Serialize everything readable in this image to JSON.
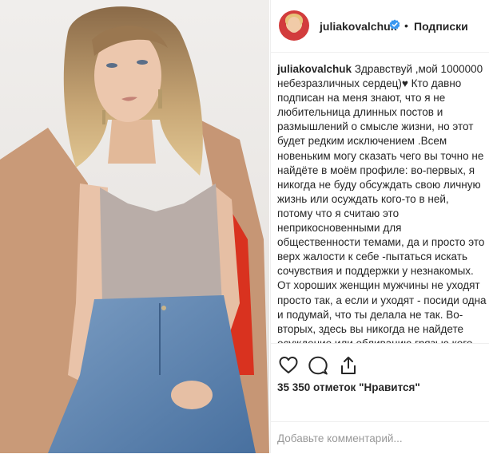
{
  "post": {
    "username": "juliakovalchuk",
    "separator": "•",
    "follow_label": "Подписки",
    "caption_text": "Здравствуй ,мой 1000000 небезразличных сердец)♥ Кто давно подписан на меня знают, что я не любительница длинных постов и размышлений о смысле жизни, но этот будет редким исключением .Всем новеньким могу сказать чего вы точно не найдёте в моём профиле: во-первых, я никогда не буду обсуждать свою личную жизнь или осуждать кого-то в ней, потому что я считаю это неприкосновенными для общественности темами, да и просто это верх жалости к себе -пытаться искать сочувствия и поддержки у незнакомых. От хороших женщин мужчины не уходят просто так, а если и уходят - посиди одна и подумай, что ты делала не так. Во-вторых, здесь вы никогда не найдете осуждение или обливанию грязью кого-",
    "likes_label": "35 350 отметок \"Нравится\"",
    "comment_placeholder": "Добавьте комментарий..."
  },
  "icons": {
    "avatar": "avatar-photo",
    "verified": "verified-badge-icon",
    "like": "heart-icon",
    "comment": "comment-bubble-icon",
    "share": "share-icon"
  },
  "colors": {
    "verified": "#3897f0",
    "text": "#262626",
    "placeholder": "#999999",
    "coat": "#c99a78",
    "coat_lining": "#d9321f",
    "jeans": "#5b82ad",
    "top": "#b9ada8",
    "hair": "#b08a5c",
    "skin": "#e9c3a9"
  }
}
